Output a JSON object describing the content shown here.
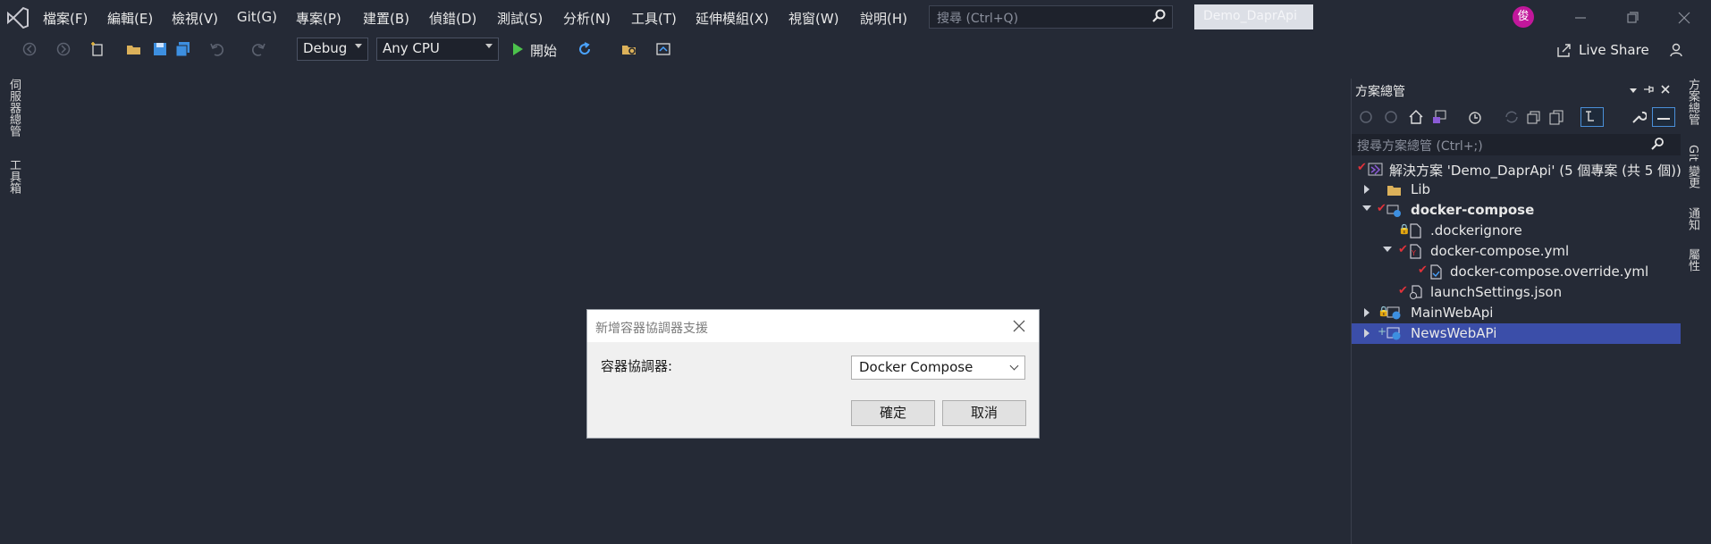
{
  "menu": {
    "items": [
      "檔案(F)",
      "編輯(E)",
      "檢視(V)",
      "Git(G)",
      "專案(P)",
      "建置(B)",
      "偵錯(D)",
      "測試(S)",
      "分析(N)",
      "工具(T)",
      "延伸模組(X)",
      "視窗(W)",
      "說明(H)"
    ],
    "search_placeholder": "搜尋 (Ctrl+Q)",
    "solution_name": "Demo_DaprApi",
    "avatar_initial": "俊"
  },
  "toolbar": {
    "config": "Debug",
    "platform": "Any CPU",
    "start_label": "開始",
    "live_share": "Live Share"
  },
  "left_tabs": [
    "伺服器總管",
    "工具箱"
  ],
  "right_tabs": [
    "方案總管",
    "Git 變更",
    "通知",
    "屬性"
  ],
  "solution_explorer": {
    "title": "方案總管",
    "search_placeholder": "搜尋方案總管 (Ctrl+;)",
    "tree": [
      {
        "label": "解決方案 'Demo_DaprApi' (5 個專案 (共 5 個))",
        "icon": "solution-icon"
      },
      {
        "label": "Lib",
        "icon": "folder-icon"
      },
      {
        "label": "docker-compose",
        "icon": "docker-project-icon"
      },
      {
        "label": ".dockerignore",
        "icon": "file-icon"
      },
      {
        "label": "docker-compose.yml",
        "icon": "yml-file-icon"
      },
      {
        "label": "docker-compose.override.yml",
        "icon": "yml-file-icon"
      },
      {
        "label": "launchSettings.json",
        "icon": "settings-file-icon"
      },
      {
        "label": "MainWebApi",
        "icon": "web-project-icon"
      },
      {
        "label": "NewsWebAPi",
        "icon": "web-project-icon"
      }
    ]
  },
  "dialog": {
    "title": "新增容器協調器支援",
    "label": "容器協調器:",
    "selected": "Docker Compose",
    "ok": "確定",
    "cancel": "取消"
  },
  "colors": {
    "background": "#252a36",
    "selection": "#3b4ea9",
    "avatar": "#c2179b",
    "check": "#e0323a"
  }
}
